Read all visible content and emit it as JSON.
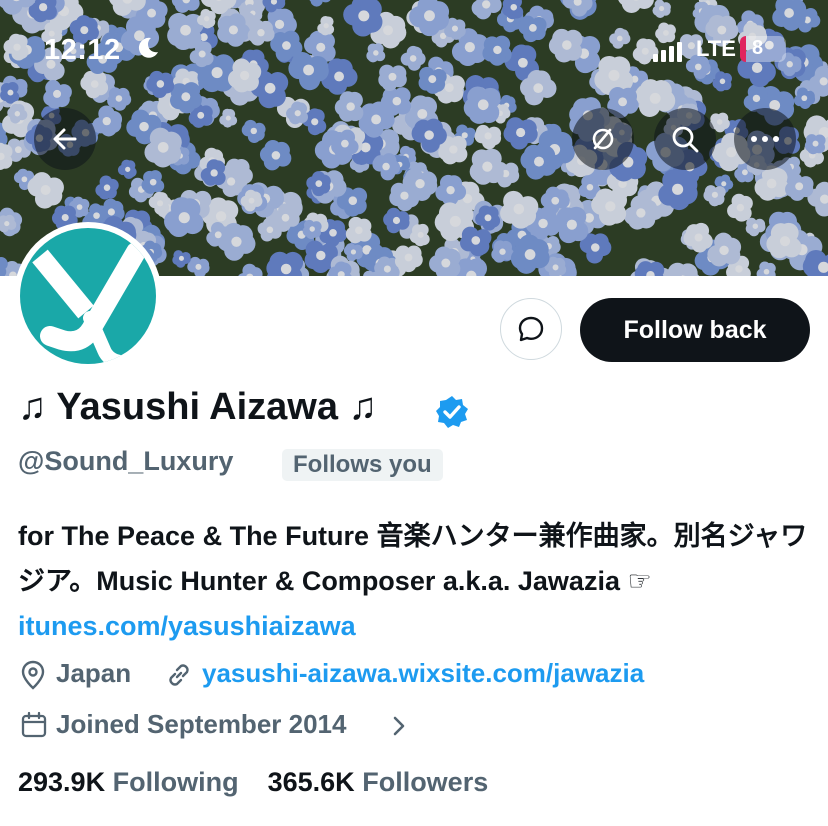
{
  "status_bar": {
    "time": "12:12",
    "network": "LTE",
    "battery": "8"
  },
  "header": {
    "back_icon": "arrow-left-icon",
    "icons": [
      "bell-slash-icon",
      "search-icon",
      "more-icon"
    ]
  },
  "profile": {
    "name": "♫ Yasushi Aizawa ♫",
    "handle": "@Sound_Luxury",
    "follows_you": "Follows you",
    "follow_button": "Follow back",
    "bio_text": "for The Peace & The Future 音楽ハンター兼作曲家。別名ジャワジア。Music Hunter & Composer a.k.a. Jawazia ☞",
    "bio_link": "itunes.com/yasushiaizawa",
    "location": "Japan",
    "website": "yasushi-aizawa.wixsite.com/jawazia",
    "joined": "Joined September 2014",
    "following_count": "293.9K",
    "following_label": "Following",
    "followers_count": "365.6K",
    "followers_label": "Followers"
  },
  "colors": {
    "accent": "#1d9bf0",
    "avatar_bg": "#1aa8a8",
    "button_bg": "#0f1419"
  }
}
